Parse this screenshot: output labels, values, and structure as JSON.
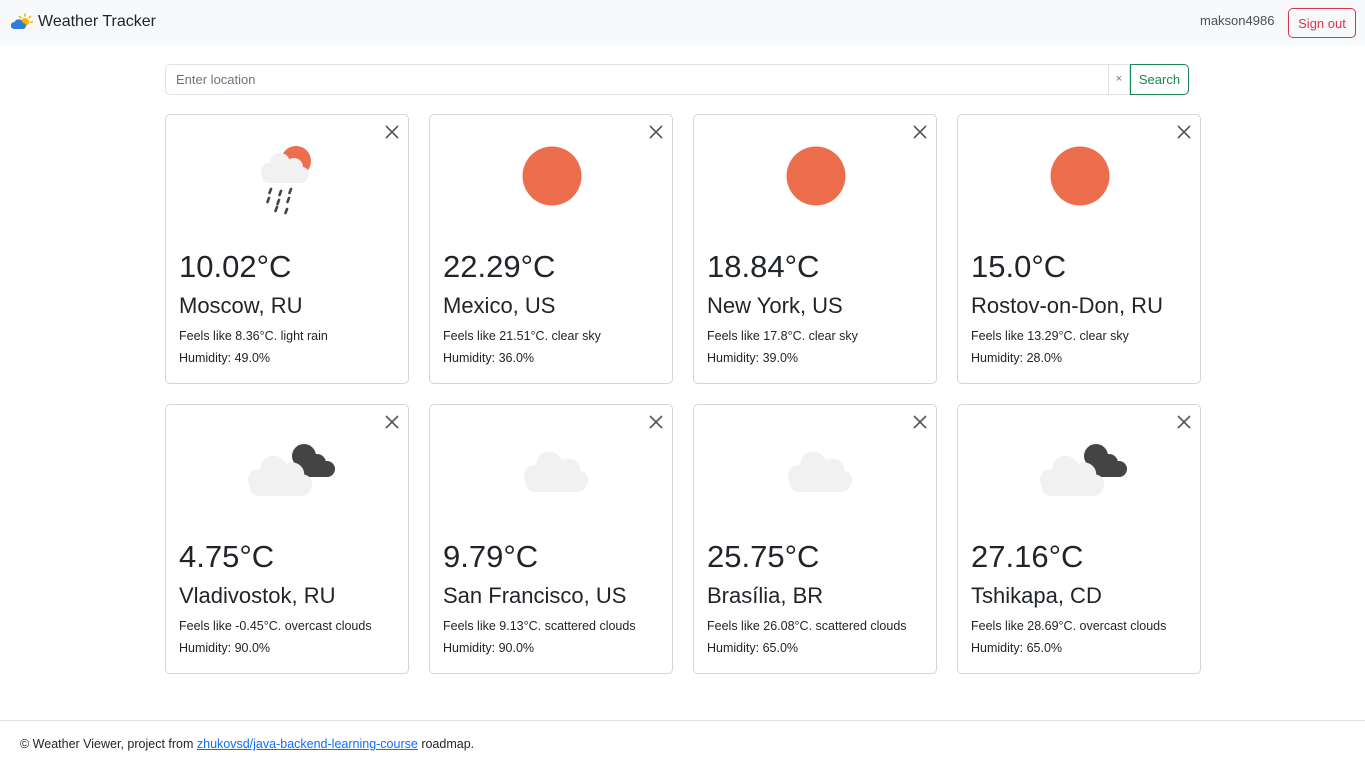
{
  "header": {
    "brand": "Weather Tracker",
    "username": "makson4986",
    "signout_label": "Sign out"
  },
  "search": {
    "placeholder": "Enter location",
    "clear_label": "×",
    "button_label": "Search"
  },
  "colors": {
    "sun": "#ec6e4c",
    "cloud_light": "#f1f1f1",
    "cloud_dark": "#444444",
    "success": "#198754",
    "danger": "#dc3545",
    "link": "#0d6efd"
  },
  "cards": [
    {
      "icon": "light-rain-icon",
      "temp": "10.02°C",
      "city": "Moscow, RU",
      "desc": "Feels like 8.36°C. light rain",
      "humidity": "Humidity: 49.0%"
    },
    {
      "icon": "clear-sky-icon",
      "temp": "22.29°C",
      "city": "Mexico, US",
      "desc": "Feels like 21.51°C. clear sky",
      "humidity": "Humidity: 36.0%"
    },
    {
      "icon": "clear-sky-icon",
      "temp": "18.84°C",
      "city": "New York, US",
      "desc": "Feels like 17.8°C. clear sky",
      "humidity": "Humidity: 39.0%"
    },
    {
      "icon": "clear-sky-icon",
      "temp": "15.0°C",
      "city": "Rostov-on-Don, RU",
      "desc": "Feels like 13.29°C. clear sky",
      "humidity": "Humidity: 28.0%"
    },
    {
      "icon": "overcast-clouds-icon",
      "temp": "4.75°C",
      "city": "Vladivostok, RU",
      "desc": "Feels like -0.45°C. overcast clouds",
      "humidity": "Humidity: 90.0%"
    },
    {
      "icon": "scattered-clouds-icon",
      "temp": "9.79°C",
      "city": "San Francisco, US",
      "desc": "Feels like 9.13°C. scattered clouds",
      "humidity": "Humidity: 90.0%"
    },
    {
      "icon": "scattered-clouds-icon",
      "temp": "25.75°C",
      "city": "Brasília, BR",
      "desc": "Feels like 26.08°C. scattered clouds",
      "humidity": "Humidity: 65.0%"
    },
    {
      "icon": "overcast-clouds-icon",
      "temp": "27.16°C",
      "city": "Tshikapa, CD",
      "desc": "Feels like 28.69°C. overcast clouds",
      "humidity": "Humidity: 65.0%"
    }
  ],
  "footer": {
    "prefix": "© Weather Viewer, project from ",
    "link_text": "zhukovsd/java-backend-learning-course",
    "suffix": " roadmap."
  }
}
